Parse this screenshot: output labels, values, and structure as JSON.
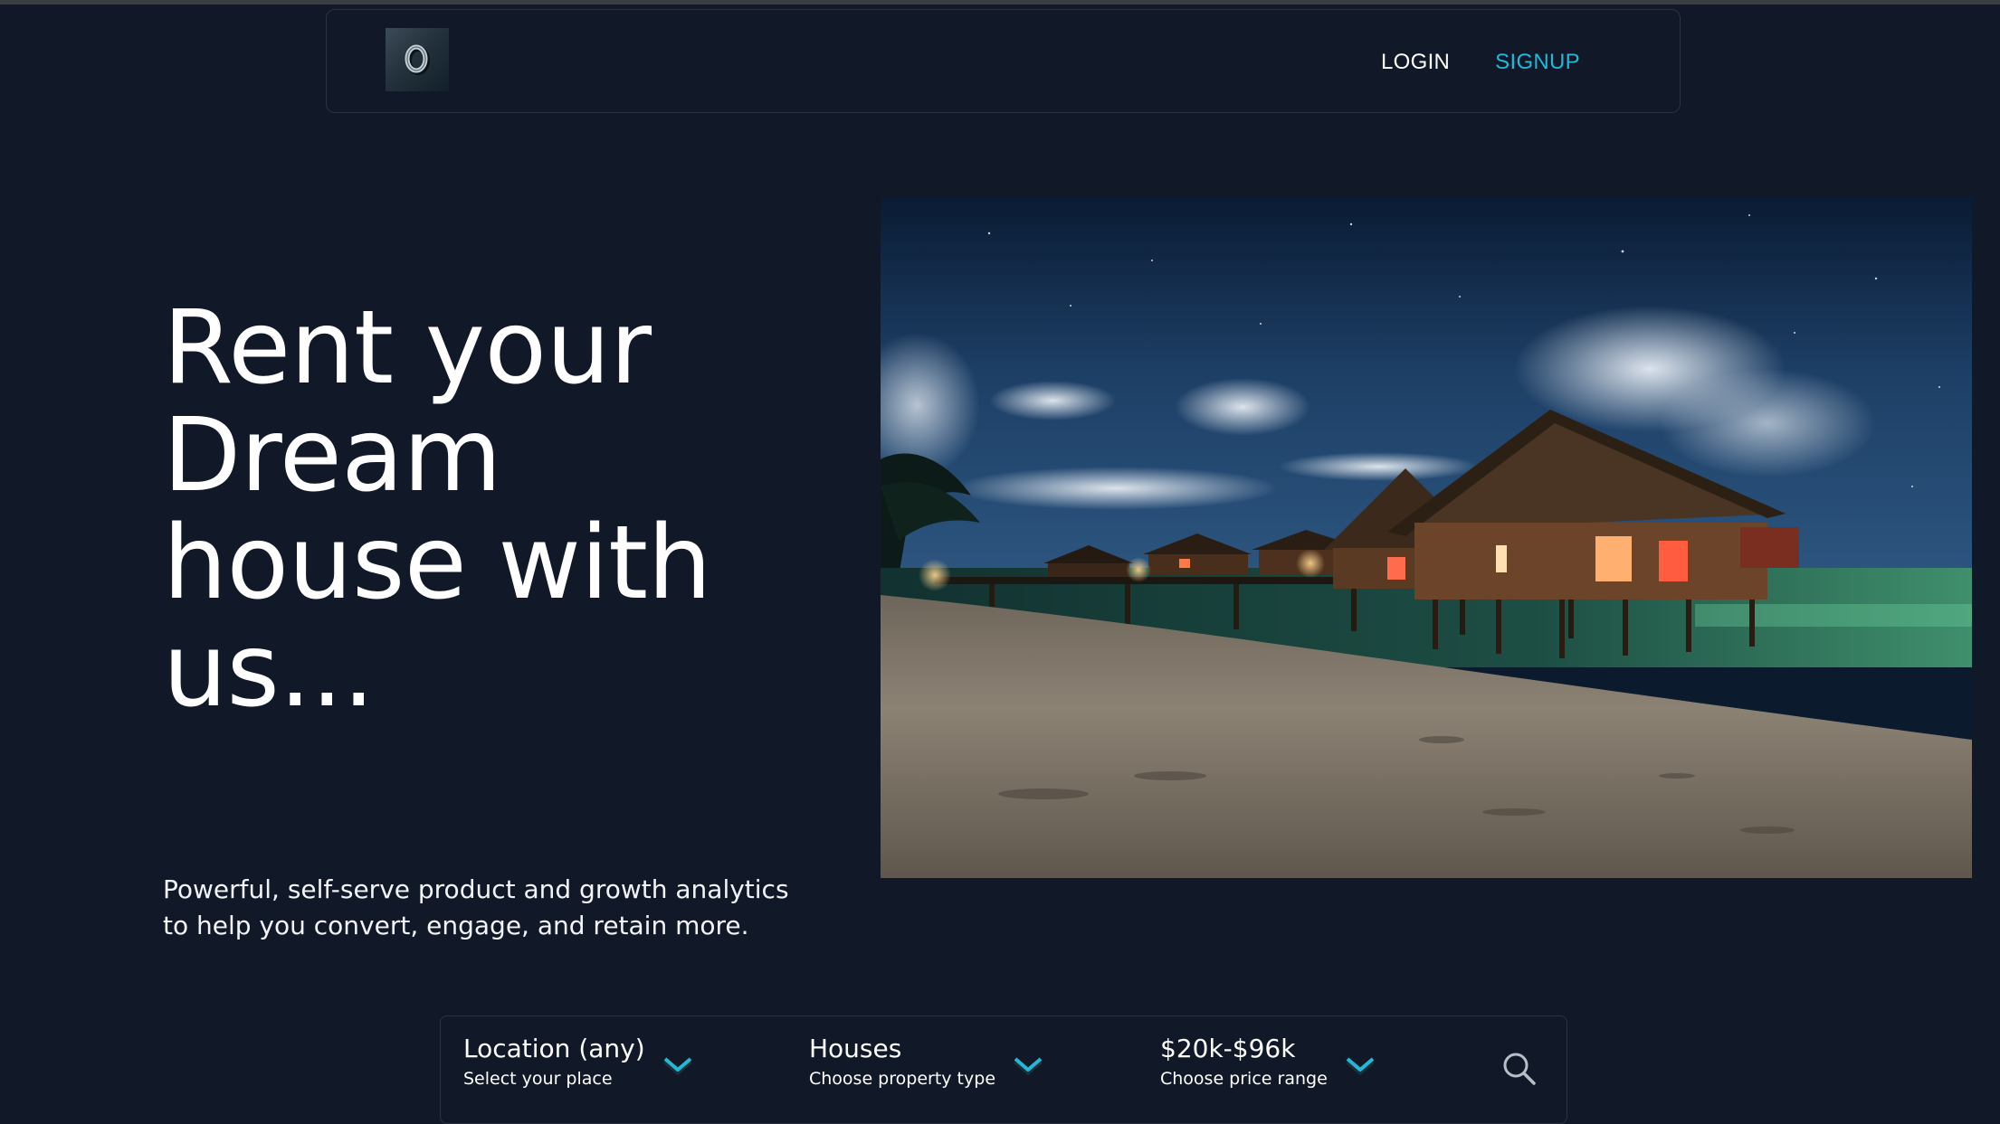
{
  "header": {
    "logo_glyph": "0",
    "login_label": "LOGIN",
    "signup_label": "SIGNUP"
  },
  "hero": {
    "title_lines": [
      "Rent your",
      "Dream",
      "house with",
      "us..."
    ],
    "subtitle_lines": [
      "Powerful, self-serve product and growth analytics",
      "to help you convert, engage, and retain more."
    ],
    "image_icon": "beach-bungalows-night-image"
  },
  "search": {
    "location": {
      "value": "Location (any)",
      "hint": "Select your place"
    },
    "property_type": {
      "value": "Houses",
      "hint": "Choose property type"
    },
    "price": {
      "value": "$20k-$96k",
      "hint": "Choose price range"
    },
    "search_icon": "search-icon",
    "dropdown_icon": "chevron-down-icon"
  },
  "colors": {
    "background": "#111827",
    "accent": "#22b8d6",
    "border": "#2b3340",
    "text": "#ffffff"
  }
}
